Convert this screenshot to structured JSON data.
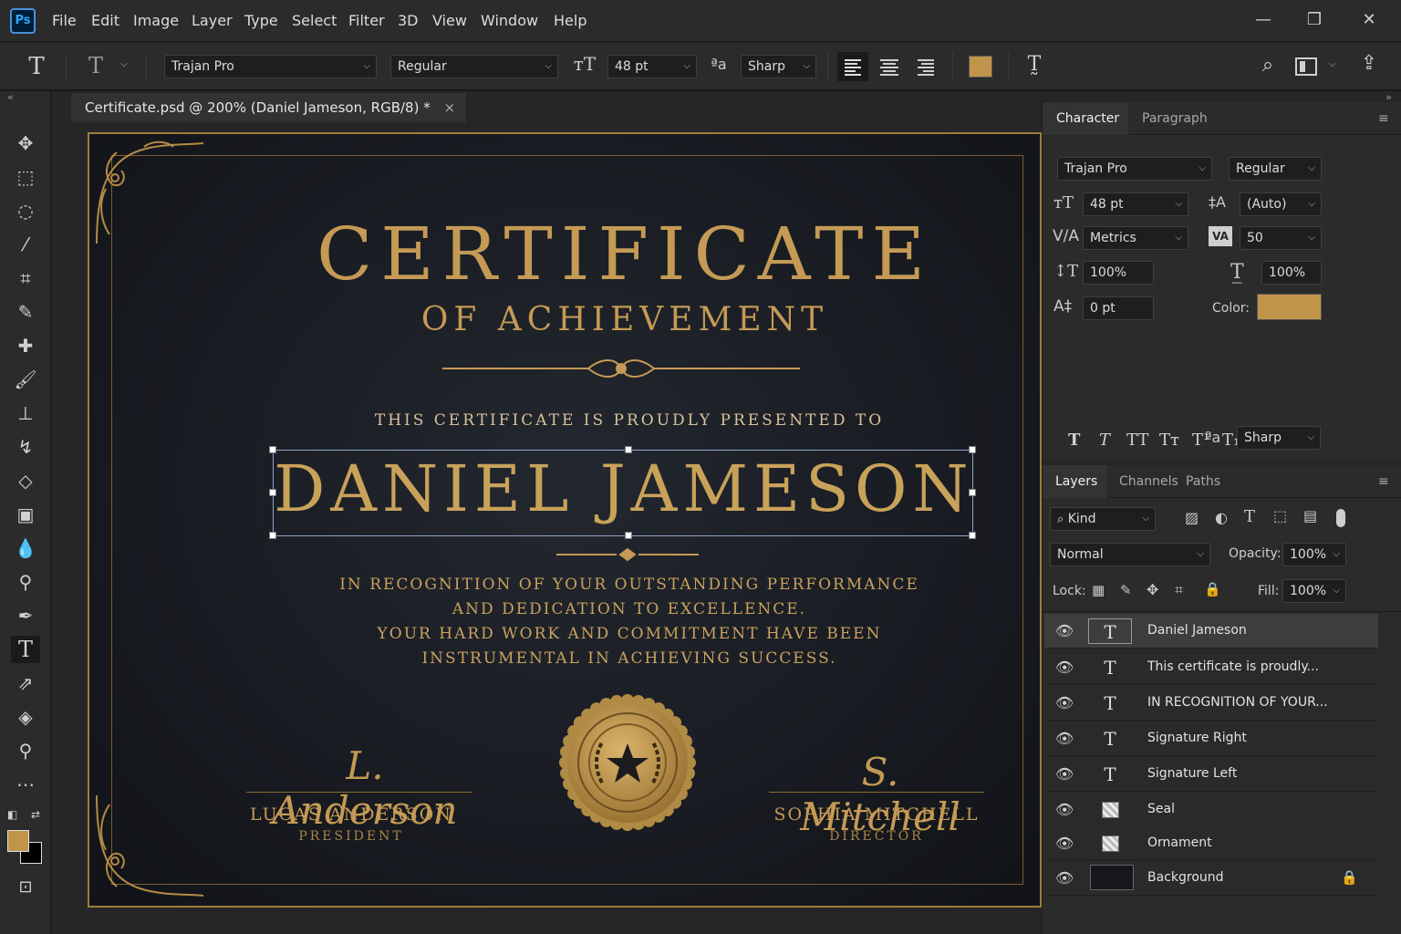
{
  "app": {
    "logo": "Ps",
    "menu": [
      "File",
      "Edit",
      "Image",
      "Layer",
      "Type",
      "Select",
      "Filter",
      "3D",
      "View",
      "Window",
      "Help"
    ]
  },
  "options": {
    "font_family": "Trajan Pro",
    "font_style": "Regular",
    "font_size": "48 pt",
    "antialias": "Sharp",
    "color": "#c0954a"
  },
  "document": {
    "tab_title": "Certificate.psd @ 200% (Daniel Jameson, RGB/8) *",
    "close_symbol": "×"
  },
  "certificate": {
    "title": "CERTIFICATE",
    "subtitle": "OF ACHIEVEMENT",
    "presented": "THIS CERTIFICATE IS PROUDLY PRESENTED TO",
    "recipient": "DANIEL JAMESON",
    "body": [
      "IN RECOGNITION OF YOUR OUTSTANDING PERFORMANCE",
      "AND DEDICATION TO EXCELLENCE.",
      "YOUR HARD WORK AND COMMITMENT HAVE BEEN",
      "INSTRUMENTAL IN ACHIEVING SUCCESS."
    ],
    "signatures": [
      {
        "script": "L. Anderson",
        "name": "LUCAS ANDERSON",
        "role": "PRESIDENT"
      },
      {
        "script": "S. Mitchell",
        "name": "SOPHIA MITCHELL",
        "role": "DIRECTOR"
      }
    ]
  },
  "character_panel": {
    "tabs": [
      "Character",
      "Paragraph"
    ],
    "font_family": "Trajan Pro",
    "font_style": "Regular",
    "size": "48 pt",
    "leading": "(Auto)",
    "kerning": "Metrics",
    "tracking": "50",
    "vertical_scale": "100%",
    "horizontal_scale": "100%",
    "baseline_shift": "0 pt",
    "color_label": "Color:",
    "color": "#c0954a",
    "antialias": "Sharp"
  },
  "layers_panel": {
    "tabs": [
      "Layers",
      "Channels",
      "Paths"
    ],
    "filter": "Kind",
    "blend_mode": "Normal",
    "opacity_label": "Opacity:",
    "opacity": "100%",
    "lock_label": "Lock:",
    "fill_label": "Fill:",
    "fill": "100%",
    "layers": [
      {
        "name": "Daniel Jameson",
        "type": "text",
        "selected": true
      },
      {
        "name": "This certificate is proudly...",
        "type": "text"
      },
      {
        "name": "IN RECOGNITION OF YOUR...",
        "type": "text"
      },
      {
        "name": "Signature Right",
        "type": "text"
      },
      {
        "name": "Signature Left",
        "type": "text"
      },
      {
        "name": "Seal",
        "type": "smart"
      },
      {
        "name": "Ornament",
        "type": "smart"
      },
      {
        "name": "Background",
        "type": "background",
        "locked": true
      }
    ]
  }
}
